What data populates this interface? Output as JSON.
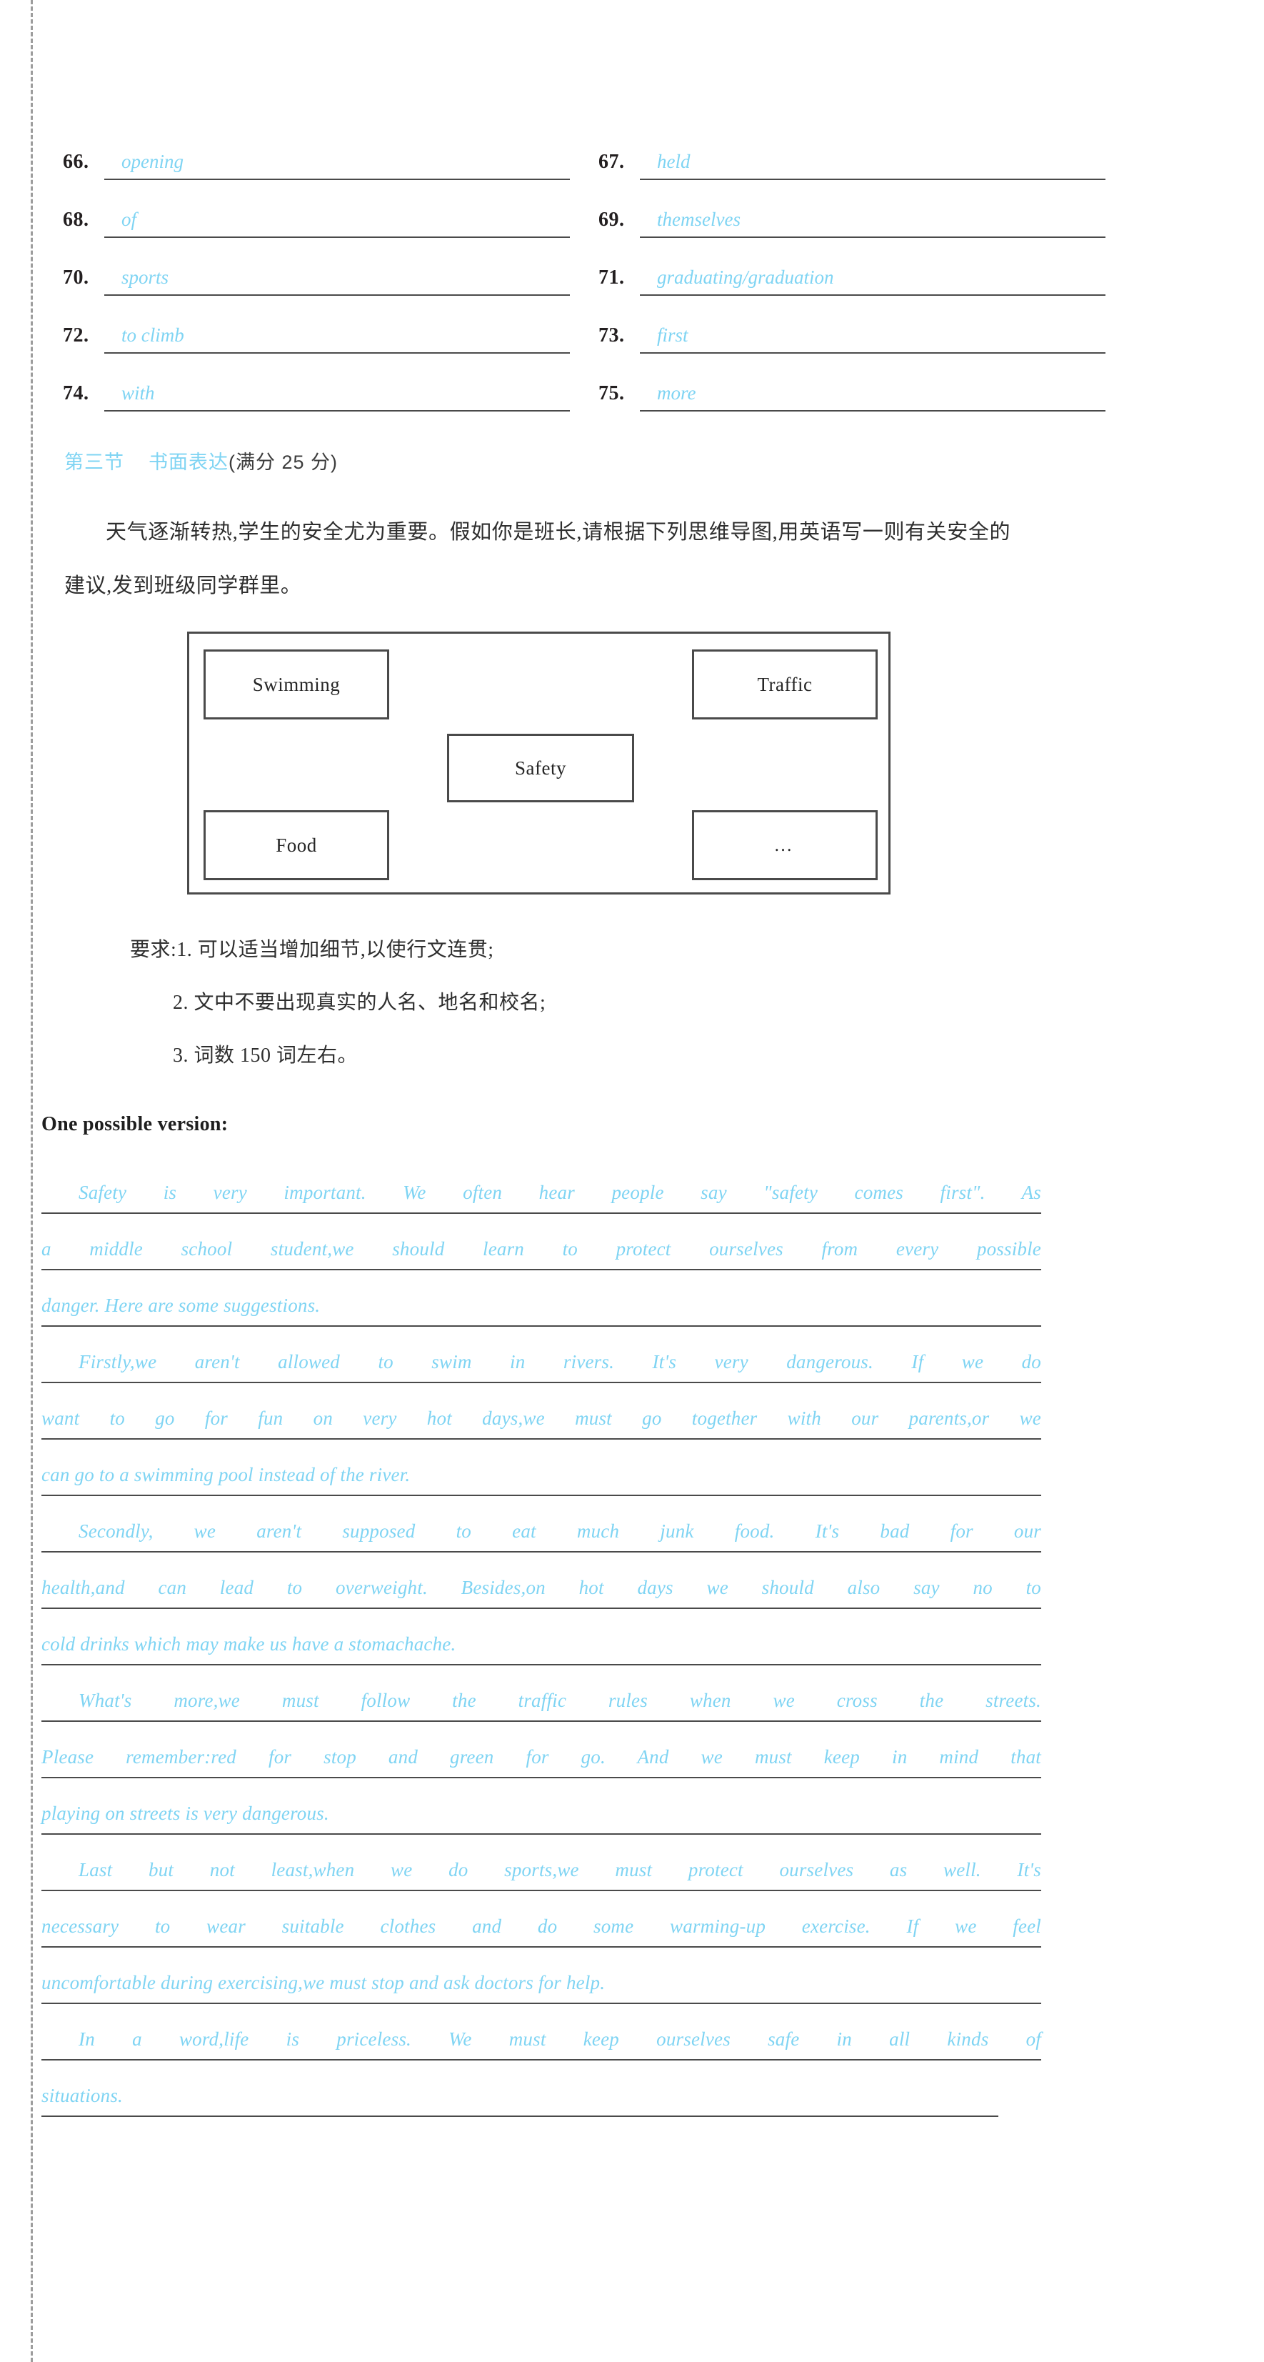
{
  "answers": {
    "rows": [
      {
        "left": {
          "num": "66.",
          "value": "opening"
        },
        "right": {
          "num": "67.",
          "value": "held"
        }
      },
      {
        "left": {
          "num": "68.",
          "value": "of"
        },
        "right": {
          "num": "69.",
          "value": "themselves"
        }
      },
      {
        "left": {
          "num": "70.",
          "value": "sports"
        },
        "right": {
          "num": "71.",
          "value": "graduating/graduation"
        }
      },
      {
        "left": {
          "num": "72.",
          "value": "to climb"
        },
        "right": {
          "num": "73.",
          "value": "first"
        }
      },
      {
        "left": {
          "num": "74.",
          "value": "with"
        },
        "right": {
          "num": "75.",
          "value": "more"
        }
      }
    ]
  },
  "section": {
    "label": "第三节",
    "title": "书面表达",
    "score": "(满分 25 分)"
  },
  "prompt": {
    "text": "天气逐渐转热,学生的安全尤为重要。假如你是班长,请根据下列思维导图,用英语写一则有关安全的建议,发到班级同学群里。"
  },
  "diagram": {
    "top_left": "Swimming",
    "top_right": "Traffic",
    "center": "Safety",
    "bottom_left": "Food",
    "bottom_right": "…"
  },
  "requirements": {
    "line1": "要求:1. 可以适当增加细节,以使行文连贯;",
    "line2": "2. 文中不要出现真实的人名、地名和校名;",
    "line3": "3. 词数 150 词左右。"
  },
  "version": {
    "title": "One possible version:"
  },
  "essay": {
    "lines": [
      {
        "text": "Safety is very important. We often hear people say \"safety comes first\". As",
        "indent": true,
        "justify": true,
        "short": false
      },
      {
        "text": "a middle school student,we should learn to protect ourselves from every possible",
        "indent": false,
        "justify": true,
        "short": false
      },
      {
        "text": "danger. Here are some suggestions.",
        "indent": false,
        "justify": false,
        "short": false
      },
      {
        "text": "Firstly,we aren't allowed to swim in rivers. It's very dangerous. If we do",
        "indent": true,
        "justify": true,
        "short": false
      },
      {
        "text": "want to go for fun on very hot days,we must go together with our parents,or we",
        "indent": false,
        "justify": true,
        "short": false
      },
      {
        "text": "can go to a swimming pool instead of the river.",
        "indent": false,
        "justify": false,
        "short": false
      },
      {
        "text": "Secondly, we aren't supposed to eat much junk food. It's bad for our",
        "indent": true,
        "justify": true,
        "short": false
      },
      {
        "text": "health,and can lead to overweight. Besides,on hot days we should also say no to",
        "indent": false,
        "justify": true,
        "short": false
      },
      {
        "text": "cold drinks which may make us have a stomachache.",
        "indent": false,
        "justify": false,
        "short": false
      },
      {
        "text": "What's more,we must follow the traffic rules when we cross the streets.",
        "indent": true,
        "justify": true,
        "short": false
      },
      {
        "text": "Please remember:red for stop and green for go. And we must keep in mind that",
        "indent": false,
        "justify": true,
        "short": false
      },
      {
        "text": "playing on streets is very dangerous.",
        "indent": false,
        "justify": false,
        "short": false
      },
      {
        "text": "Last but not least,when we do sports,we must protect ourselves as well. It's",
        "indent": true,
        "justify": true,
        "short": false
      },
      {
        "text": "necessary to wear suitable clothes and do some warming-up exercise. If we feel",
        "indent": false,
        "justify": true,
        "short": false
      },
      {
        "text": "uncomfortable during exercising,we must stop and ask doctors for help.",
        "indent": false,
        "justify": false,
        "short": false
      },
      {
        "text": "In a word,life is priceless. We must keep ourselves safe in all kinds of",
        "indent": true,
        "justify": true,
        "short": false
      },
      {
        "text": "situations.",
        "indent": false,
        "justify": false,
        "short": true
      }
    ]
  },
  "colors": {
    "answer_ink": "#7fd4f3",
    "rule": "#4a4a4a",
    "body_text": "#2e2e2e"
  }
}
